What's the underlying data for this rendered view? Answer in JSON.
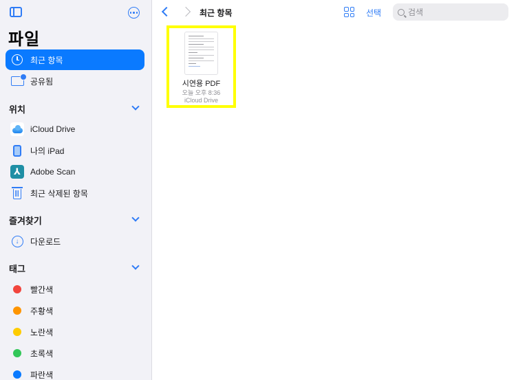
{
  "app": {
    "title": "파일"
  },
  "sidebar": {
    "toggle_icon": "sidebar-icon",
    "more_icon": "ellipsis-circle-icon",
    "top_items": [
      {
        "label": "최근 항목",
        "icon": "clock-icon",
        "active": true
      },
      {
        "label": "공유됨",
        "icon": "shared-folder-icon",
        "active": false
      }
    ],
    "sections": {
      "locations": {
        "title": "위치",
        "items": [
          {
            "label": "iCloud Drive",
            "icon": "icloud-icon"
          },
          {
            "label": "나의 iPad",
            "icon": "ipad-icon"
          },
          {
            "label": "Adobe Scan",
            "icon": "adobe-scan-icon"
          },
          {
            "label": "최근 삭제된 항목",
            "icon": "trash-icon"
          }
        ]
      },
      "favorites": {
        "title": "즐겨찾기",
        "items": [
          {
            "label": "다운로드",
            "icon": "download-icon"
          }
        ]
      },
      "tags": {
        "title": "태그",
        "items": [
          {
            "label": "빨간색",
            "color": "#f2453d"
          },
          {
            "label": "주황색",
            "color": "#fe9500"
          },
          {
            "label": "노란색",
            "color": "#fecc00"
          },
          {
            "label": "초록색",
            "color": "#33c759"
          },
          {
            "label": "파란색",
            "color": "#0a7aff"
          }
        ]
      }
    }
  },
  "toolbar": {
    "breadcrumb": "최근 항목",
    "select_label": "선택",
    "search_placeholder": "검색"
  },
  "files": [
    {
      "name": "시연용 PDF",
      "date": "오늘 오후 8:36",
      "location": "iCloud Drive",
      "highlighted": true
    }
  ],
  "colors": {
    "accent": "#0a7aff",
    "highlight": "#ffff00"
  }
}
